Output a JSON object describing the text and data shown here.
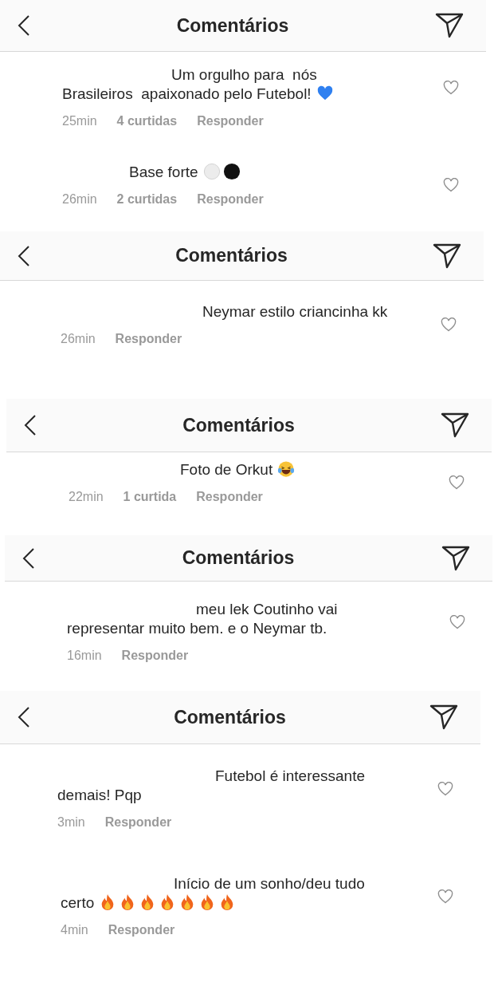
{
  "panels": [
    {
      "title": "Comentários",
      "comments": [
        {
          "lines": [
            "Um orgulho para  nós",
            "Brasileiros  apaixonado pelo Futebol!"
          ],
          "emoji": [
            {
              "kind": "blue-heart"
            }
          ],
          "time": "25min",
          "likes": "4 curtidas",
          "reply": "Responder",
          "liked": false
        },
        {
          "lines": [
            "Base forte"
          ],
          "emoji": [
            {
              "kind": "white-circle"
            },
            {
              "kind": "black-circle"
            }
          ],
          "time": "26min",
          "likes": "2 curtidas",
          "reply": "Responder",
          "liked": false
        }
      ]
    },
    {
      "title": "Comentários",
      "comments": [
        {
          "lines": [
            "Neymar estilo criancinha kk"
          ],
          "time": "26min",
          "reply": "Responder",
          "liked": false
        }
      ]
    },
    {
      "title": "Comentários",
      "comments": [
        {
          "lines": [
            "Foto de Orkut"
          ],
          "emoji": [
            {
              "kind": "laughing"
            }
          ],
          "time": "22min",
          "likes": "1 curtida",
          "reply": "Responder",
          "liked": false
        }
      ]
    },
    {
      "title": "Comentários",
      "comments": [
        {
          "lines": [
            "meu lek Coutinho vai",
            "representar muito bem. e o Neymar tb."
          ],
          "time": "16min",
          "reply": "Responder",
          "liked": false
        }
      ]
    },
    {
      "title": "Comentários",
      "comments": [
        {
          "lines": [
            "Futebol é interessante",
            "demais! Pqp"
          ],
          "time": "3min",
          "reply": "Responder",
          "liked": false
        },
        {
          "lines": [
            "Início de um sonho/deu tudo",
            "certo"
          ],
          "emoji": [
            {
              "kind": "fire"
            },
            {
              "kind": "fire"
            },
            {
              "kind": "fire"
            },
            {
              "kind": "fire"
            },
            {
              "kind": "fire"
            },
            {
              "kind": "fire"
            },
            {
              "kind": "fire"
            }
          ],
          "time": "4min",
          "reply": "Responder",
          "liked": false
        }
      ]
    }
  ]
}
